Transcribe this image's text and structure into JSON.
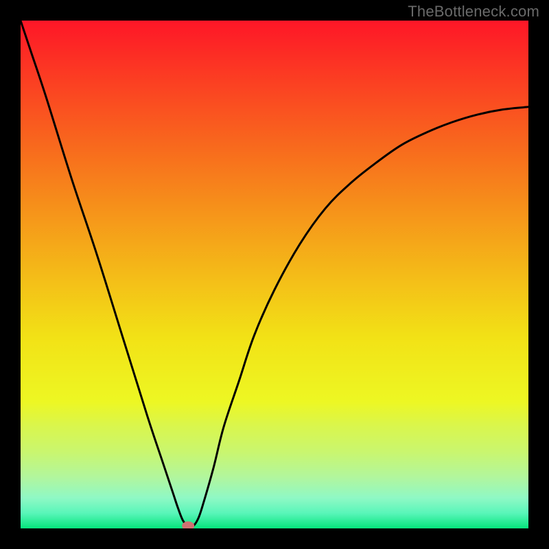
{
  "watermark": "TheBottleneck.com",
  "chart_data": {
    "type": "line",
    "title": "",
    "xlabel": "",
    "ylabel": "",
    "xlim": [
      0,
      100
    ],
    "ylim": [
      0,
      100
    ],
    "x": [
      0,
      2,
      5,
      10,
      15,
      20,
      25,
      28,
      30,
      31,
      32,
      33,
      34,
      35,
      36,
      38,
      40,
      43,
      46,
      50,
      55,
      60,
      65,
      70,
      75,
      80,
      85,
      90,
      95,
      100
    ],
    "values": [
      100,
      94,
      85,
      69,
      54,
      38,
      22,
      13,
      7,
      4,
      1.5,
      0.5,
      0.5,
      2,
      5,
      12,
      20,
      29,
      38,
      47,
      56,
      63,
      68,
      72,
      75.5,
      78,
      80,
      81.5,
      82.5,
      83
    ],
    "marker": {
      "x": 33,
      "y": 0.5
    },
    "gradient_stops": [
      {
        "offset": 0.0,
        "color": "#fe1627"
      },
      {
        "offset": 0.125,
        "color": "#fb4122"
      },
      {
        "offset": 0.25,
        "color": "#f86a1d"
      },
      {
        "offset": 0.375,
        "color": "#f6931a"
      },
      {
        "offset": 0.5,
        "color": "#f4bb18"
      },
      {
        "offset": 0.625,
        "color": "#f2e216"
      },
      {
        "offset": 0.75,
        "color": "#edf723"
      },
      {
        "offset": 0.8,
        "color": "#d9f64e"
      },
      {
        "offset": 0.85,
        "color": "#c9f66f"
      },
      {
        "offset": 0.9,
        "color": "#b1f69e"
      },
      {
        "offset": 0.94,
        "color": "#8ff8c5"
      },
      {
        "offset": 0.97,
        "color": "#59f6b9"
      },
      {
        "offset": 1.0,
        "color": "#05e47c"
      }
    ],
    "marker_color": "#cf7272",
    "curve_color": "#000000"
  }
}
